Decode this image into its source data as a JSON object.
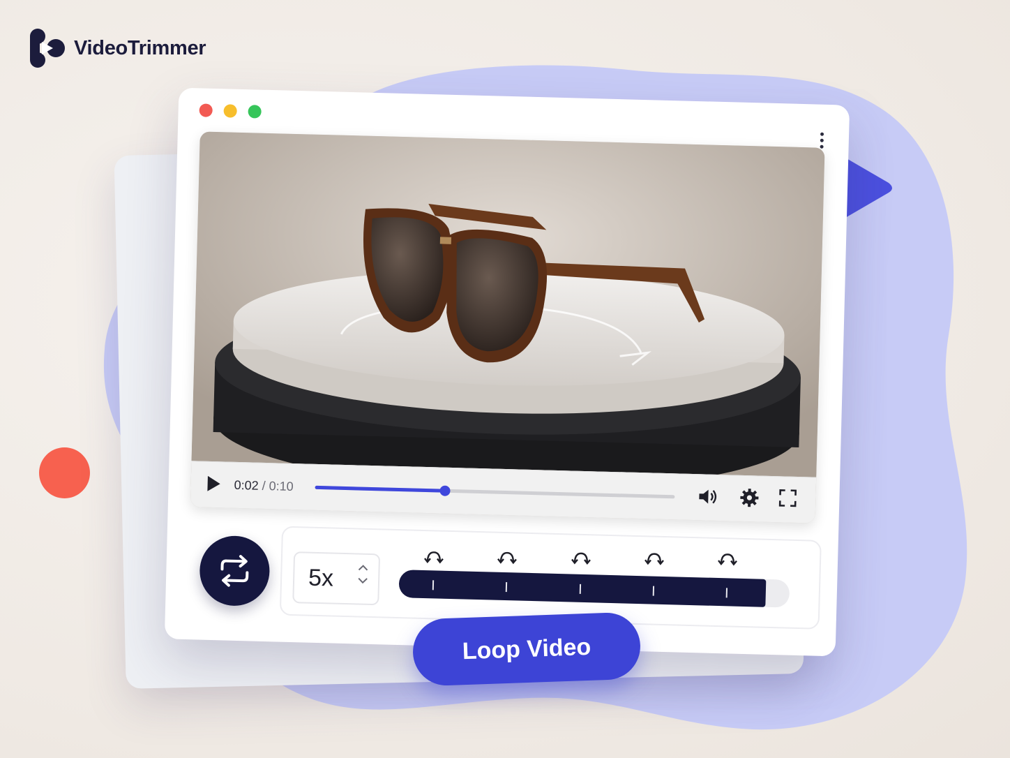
{
  "brand": {
    "name": "VideoTrimmer"
  },
  "player": {
    "current_time": "0:02",
    "separator": " / ",
    "total_time": "0:10",
    "progress": 0.36
  },
  "loop": {
    "count_value": "5x",
    "loop_count": 5,
    "fill_fraction": 0.94
  },
  "cta": {
    "label": "Loop Video"
  },
  "colors": {
    "accent": "#3d44d6",
    "navy": "#15173f",
    "blob": "#c6cbf7",
    "coral": "#f7614f"
  }
}
